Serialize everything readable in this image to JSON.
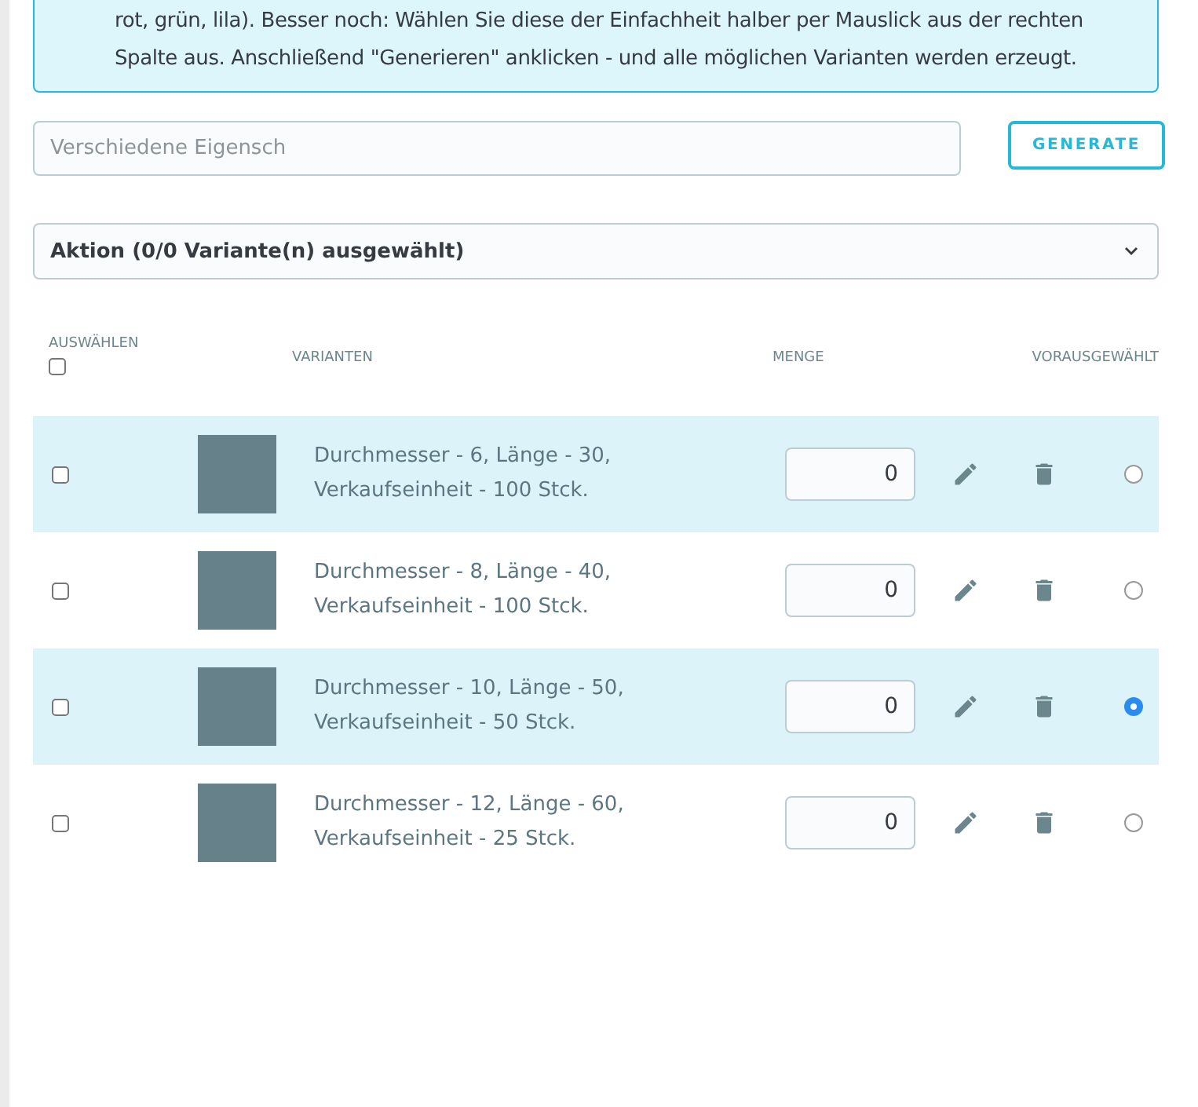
{
  "alert": {
    "text": "rot, grün, lila). Besser noch: Wählen Sie diese der Einfachheit halber per Mauslick aus der rechten Spalte aus. Anschließend \"Generieren\" anklicken - und alle möglichen Varianten werden erzeugt."
  },
  "attribute_field": {
    "placeholder": "Verschiedene Eigensch"
  },
  "generate_button": "GENERATE",
  "action_select": {
    "value": "Aktion (0/0 Variante(n) ausgewählt)"
  },
  "table": {
    "columns": {
      "select": "AUSWÄHLEN",
      "variants": "VARIANTEN",
      "quantity": "MENGE",
      "preselected": "VORAUSGEWÄHLT"
    },
    "select_all_checked": false,
    "rows": [
      {
        "name": "Durchmesser - 6, Länge - 30, Verkaufseinheit - 100 Stck.",
        "quantity": "0",
        "checked": false,
        "selected": false
      },
      {
        "name": "Durchmesser - 8, Länge - 40, Verkaufseinheit - 100 Stck.",
        "quantity": "0",
        "checked": false,
        "selected": false
      },
      {
        "name": "Durchmesser - 10, Länge - 50, Verkaufseinheit - 50 Stck.",
        "quantity": "0",
        "checked": false,
        "selected": true
      },
      {
        "name": "Durchmesser - 12, Länge - 60, Verkaufseinheit - 25 Stck.",
        "quantity": "0",
        "checked": false,
        "selected": false
      }
    ]
  }
}
